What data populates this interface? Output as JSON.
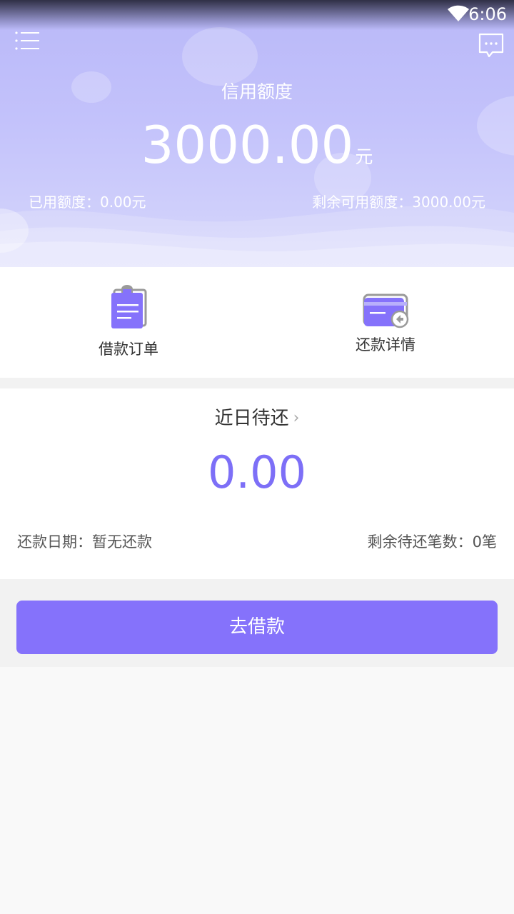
{
  "status_bar": {
    "time": "6:06"
  },
  "header": {
    "title": "信用额度",
    "amount": "3000.00",
    "unit": "元",
    "used_label": "已用额度：0.00元",
    "remaining_label": "剩余可用额度：3000.00元",
    "colors": {
      "gradient_top": "#b9b8f8",
      "gradient_bottom": "#d6d6fc"
    }
  },
  "shortcuts": [
    {
      "label": "借款订单",
      "icon": "clipboard-icon"
    },
    {
      "label": "还款详情",
      "icon": "card-icon"
    }
  ],
  "upcoming": {
    "title": "近日待还",
    "chevron": "›",
    "amount": "0.00",
    "repay_date": "还款日期：暂无还款",
    "remaining_count": "剩余待还笔数：0笔",
    "accent": "#7d6ff7"
  },
  "borrow_button": {
    "label": "去借款",
    "color": "#8572fb"
  }
}
